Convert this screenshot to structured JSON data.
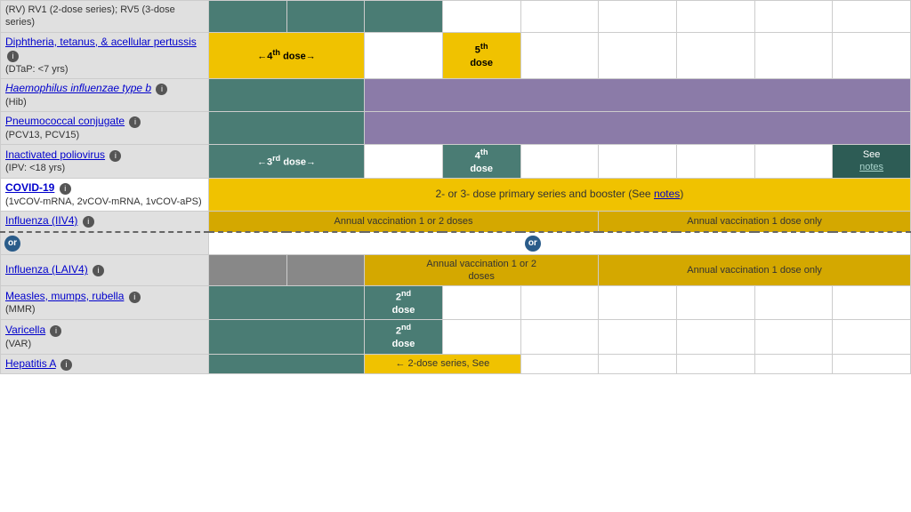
{
  "rows": [
    {
      "id": "rotavirus",
      "label": "(RV) RV1 (2-dose series); RV5 (3-dose series)",
      "link": null,
      "italic": false,
      "info": false,
      "sub": null,
      "cells": [
        {
          "text": "",
          "color": "teal",
          "colspan": 1
        },
        {
          "text": "",
          "color": "teal",
          "colspan": 1
        },
        {
          "text": "",
          "color": "teal",
          "colspan": 1
        },
        {
          "text": "",
          "color": "white-cell",
          "colspan": 1
        },
        {
          "text": "",
          "color": "white-cell",
          "colspan": 1
        },
        {
          "text": "",
          "color": "white-cell",
          "colspan": 1
        },
        {
          "text": "",
          "color": "white-cell",
          "colspan": 1
        },
        {
          "text": "",
          "color": "white-cell",
          "colspan": 1
        },
        {
          "text": "",
          "color": "white-cell",
          "colspan": 1
        }
      ]
    },
    {
      "id": "dtap",
      "label": "Diphtheria, tetanus, & acellular pertussis",
      "link": true,
      "italic": false,
      "info": true,
      "sub": "(DTaP: <7 yrs)",
      "cells": [
        {
          "text": "←4th dose→",
          "color": "yellow",
          "colspan": 2
        },
        {
          "text": "",
          "color": "white-cell",
          "colspan": 1
        },
        {
          "text": "5th\ndose",
          "color": "yellow",
          "colspan": 1
        },
        {
          "text": "",
          "color": "white-cell",
          "colspan": 1
        },
        {
          "text": "",
          "color": "white-cell",
          "colspan": 1
        },
        {
          "text": "",
          "color": "white-cell",
          "colspan": 1
        },
        {
          "text": "",
          "color": "white-cell",
          "colspan": 1
        },
        {
          "text": "",
          "color": "white-cell",
          "colspan": 1
        }
      ]
    },
    {
      "id": "hib",
      "label": "Haemophilus influenzae type b",
      "link": true,
      "italic": true,
      "info": true,
      "sub": "(Hib)",
      "cells": [
        {
          "text": "",
          "color": "teal",
          "colspan": 2
        },
        {
          "text": "",
          "color": "purple",
          "colspan": 7
        }
      ]
    },
    {
      "id": "pcv",
      "label": "Pneumococcal conjugate",
      "link": true,
      "italic": false,
      "info": true,
      "sub": "(PCV13, PCV15)",
      "cells": [
        {
          "text": "",
          "color": "teal",
          "colspan": 2
        },
        {
          "text": "",
          "color": "purple",
          "colspan": 7
        }
      ]
    },
    {
      "id": "ipv",
      "label": "Inactivated poliovirus",
      "link": true,
      "italic": false,
      "info": true,
      "sub": "(IPV: <18 yrs)",
      "cells": [
        {
          "text": "←3rd dose→",
          "color": "teal",
          "colspan": 2
        },
        {
          "text": "",
          "color": "white-cell",
          "colspan": 1
        },
        {
          "text": "4th\ndose",
          "color": "teal",
          "colspan": 1
        },
        {
          "text": "",
          "color": "white-cell",
          "colspan": 1
        },
        {
          "text": "",
          "color": "white-cell",
          "colspan": 1
        },
        {
          "text": "",
          "color": "white-cell",
          "colspan": 1
        },
        {
          "text": "",
          "color": "white-cell",
          "colspan": 1
        },
        {
          "text": "See\nnotes",
          "color": "dark-teal",
          "colspan": 1
        }
      ]
    },
    {
      "id": "covid",
      "label": "COVID-19",
      "link": true,
      "italic": false,
      "info": true,
      "sub": "(1vCOV-mRNA, 2vCOV-mRNA, 1vCOV-aPS)",
      "cells": [
        {
          "text": "2- or 3- dose primary series and booster (See notes)",
          "color": "yellow",
          "colspan": 9
        }
      ]
    },
    {
      "id": "influenza-iiv4",
      "label": "Influenza (IIV4)",
      "link": true,
      "italic": false,
      "info": true,
      "sub": null,
      "dashed": true,
      "cells": [
        {
          "text": "Annual vaccination 1 or 2 doses",
          "color": "yellow-dark",
          "colspan": 5
        },
        {
          "text": "Annual vaccination 1 dose only",
          "color": "yellow-dark",
          "colspan": 4
        }
      ]
    },
    {
      "id": "or-row",
      "label": null,
      "or": true
    },
    {
      "id": "influenza-laiv4",
      "label": "Influenza (LAIV4)",
      "link": true,
      "italic": false,
      "info": true,
      "sub": null,
      "cells": [
        {
          "text": "",
          "color": "gray-medium",
          "colspan": 1
        },
        {
          "text": "",
          "color": "gray-medium",
          "colspan": 1
        },
        {
          "text": "Annual vaccination 1 or 2\ndoses",
          "color": "yellow-dark",
          "colspan": 3
        },
        {
          "text": "Annual vaccination 1 dose only",
          "color": "yellow-dark",
          "colspan": 4
        }
      ]
    },
    {
      "id": "mmr",
      "label": "Measles, mumps, rubella",
      "link": true,
      "italic": false,
      "info": true,
      "sub": "(MMR)",
      "cells": [
        {
          "text": "",
          "color": "teal",
          "colspan": 2
        },
        {
          "text": "2nd\ndose",
          "color": "teal",
          "colspan": 1
        },
        {
          "text": "",
          "color": "white-cell",
          "colspan": 1
        },
        {
          "text": "",
          "color": "white-cell",
          "colspan": 1
        },
        {
          "text": "",
          "color": "white-cell",
          "colspan": 1
        },
        {
          "text": "",
          "color": "white-cell",
          "colspan": 1
        },
        {
          "text": "",
          "color": "white-cell",
          "colspan": 1
        },
        {
          "text": "",
          "color": "white-cell",
          "colspan": 1
        }
      ]
    },
    {
      "id": "varicella",
      "label": "Varicella",
      "link": true,
      "italic": false,
      "info": true,
      "sub": "(VAR)",
      "cells": [
        {
          "text": "",
          "color": "teal",
          "colspan": 2
        },
        {
          "text": "2nd\ndose",
          "color": "teal",
          "colspan": 1
        },
        {
          "text": "",
          "color": "white-cell",
          "colspan": 1
        },
        {
          "text": "",
          "color": "white-cell",
          "colspan": 1
        },
        {
          "text": "",
          "color": "white-cell",
          "colspan": 1
        },
        {
          "text": "",
          "color": "white-cell",
          "colspan": 1
        },
        {
          "text": "",
          "color": "white-cell",
          "colspan": 1
        },
        {
          "text": "",
          "color": "white-cell",
          "colspan": 1
        }
      ]
    },
    {
      "id": "hepatitis-a",
      "label": "Hepatitis A",
      "link": true,
      "italic": false,
      "info": true,
      "sub": null,
      "cells": [
        {
          "text": "",
          "color": "teal",
          "colspan": 2
        },
        {
          "text": "← 2-dose series, See",
          "color": "yellow",
          "colspan": 2
        },
        {
          "text": "",
          "color": "white-cell",
          "colspan": 1
        },
        {
          "text": "",
          "color": "white-cell",
          "colspan": 1
        },
        {
          "text": "",
          "color": "white-cell",
          "colspan": 1
        },
        {
          "text": "",
          "color": "white-cell",
          "colspan": 1
        },
        {
          "text": "",
          "color": "white-cell",
          "colspan": 1
        }
      ]
    }
  ],
  "colors": {
    "teal": "#4a7c74",
    "teal-dark": "#3d6b62",
    "purple": "#8b7ba8",
    "yellow": "#f0c200",
    "yellow-dark": "#d4a800",
    "gray-medium": "#888",
    "dark-teal": "#2d5c55",
    "white-cell": "#ffffff",
    "row-gray": "#d0d0d0"
  }
}
